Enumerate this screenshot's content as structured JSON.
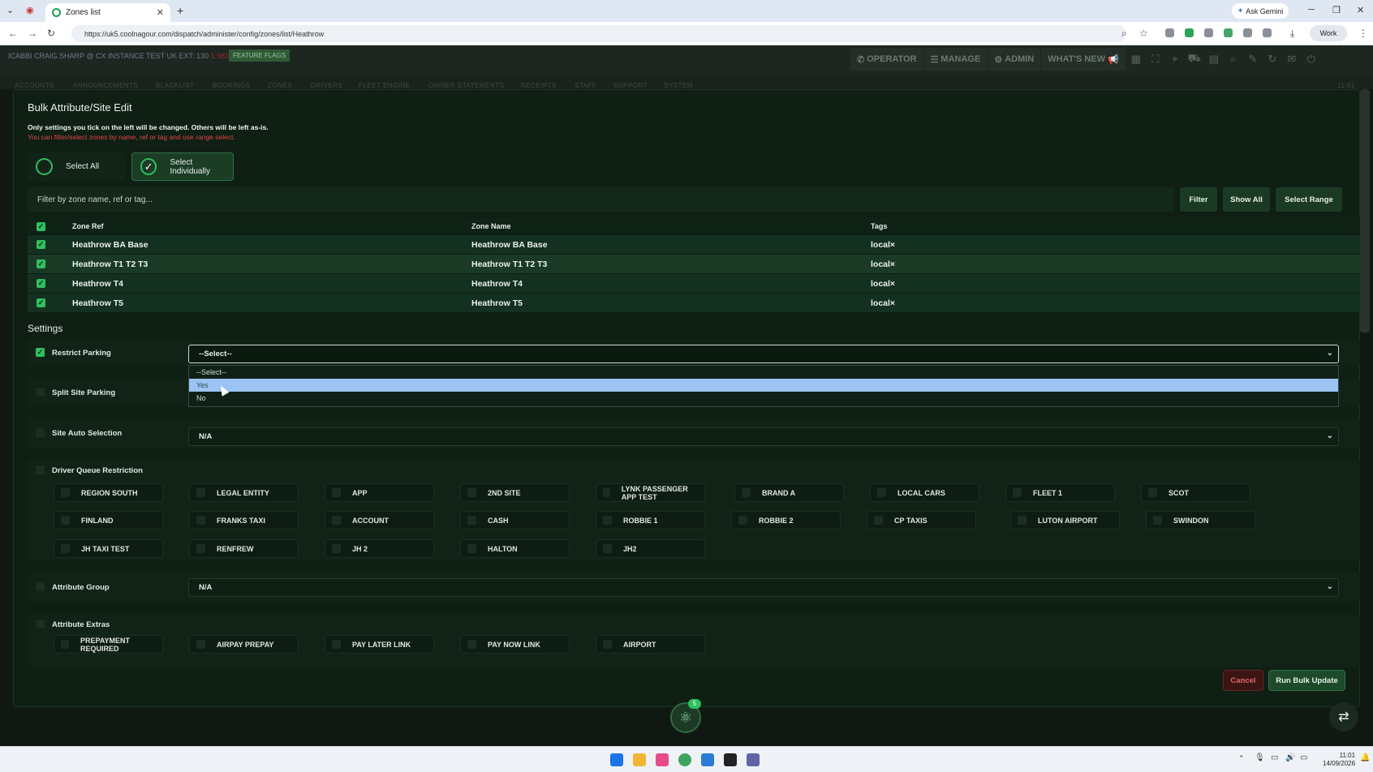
{
  "browser": {
    "tab_title": "Zones list",
    "url": "https://uk5.coolnagour.com/dispatch/administer/config/zones/list/Heathrow",
    "gemini_label": "Ask Gemini",
    "profile_label": "Work"
  },
  "app": {
    "user_line": "ICABBI CRAIG.SHARP @ CX INSTANCE TEST UK EXT: 130",
    "user_suffix": "1.9818",
    "feature_flags": "FEATURE FLAGS",
    "topnav": [
      "OPERATOR",
      "MANAGE",
      "ADMIN",
      "WHAT'S NEW"
    ],
    "subnav": [
      "ACCOUNTS",
      "ANNOUNCEMENTS",
      "BLACKLIST",
      "BOOKINGS",
      "ZONES",
      "DRIVERS",
      "FLEET ENGINE",
      "OWNER STATEMENTS",
      "RECEIPTS",
      "STAFF",
      "SUPPORT",
      "SYSTEM"
    ],
    "subnav_time": "11:01"
  },
  "form": {
    "title": "Bulk Attribute/Site Edit",
    "note": "Only settings you tick on the left will be changed. Others will be left as-is.",
    "hint": "You can filter/select zones by name, ref or tag and use range select.",
    "select_all": "Select All",
    "select_individually": "Select Individually",
    "filter_placeholder": "Filter by zone name, ref or tag...",
    "filter_btn": "Filter",
    "show_all_btn": "Show All",
    "select_range_btn": "Select Range",
    "columns": [
      "Zone Ref",
      "Zone Name",
      "Tags"
    ],
    "zones": [
      {
        "ref": "Heathrow BA Base",
        "name": "Heathrow BA Base",
        "tag": "local×"
      },
      {
        "ref": "Heathrow T1 T2 T3",
        "name": "Heathrow T1 T2 T3",
        "tag": "local×"
      },
      {
        "ref": "Heathrow T4",
        "name": "Heathrow T4",
        "tag": "local×"
      },
      {
        "ref": "Heathrow T5",
        "name": "Heathrow T5",
        "tag": "local×"
      }
    ],
    "settings_heading": "Settings",
    "restrict_parking": "Restrict Parking",
    "restrict_parking_value": "--Select--",
    "dropdown_options": [
      "--Select--",
      "Yes",
      "No"
    ],
    "split_site_parking": "Split Site Parking",
    "site_auto_selection": "Site Auto Selection",
    "site_auto_value": "N/A",
    "driver_queue": "Driver Queue Restriction",
    "queue_tags": [
      "REGION SOUTH",
      "LEGAL ENTITY",
      "APP",
      "2ND SITE",
      "LYNK PASSENGER APP TEST",
      "BRAND A",
      "LOCAL CARS",
      "FLEET 1",
      "SCOT",
      "FINLAND",
      "FRANKS TAXI",
      "ACCOUNT",
      "CASH",
      "ROBBIE 1",
      "ROBBIE 2",
      "CP TAXIS",
      "LUTON AIRPORT",
      "SWINDON",
      "JH TAXI TEST",
      "RENFREW",
      "JH 2",
      "HALTON",
      "JH2"
    ],
    "attribute_group": "Attribute Group",
    "attribute_group_value": "N/A",
    "attribute_extras": "Attribute Extras",
    "extras_tags": [
      "PREPAYMENT REQUIRED",
      "AIRPAY PREPAY",
      "PAY LATER LINK",
      "PAY NOW LINK",
      "AIRPORT"
    ],
    "cancel": "Cancel",
    "run": "Run Bulk Update"
  },
  "fab_badge": "5",
  "taskbar": {
    "time": "11:01",
    "date": "14/09/2026"
  }
}
